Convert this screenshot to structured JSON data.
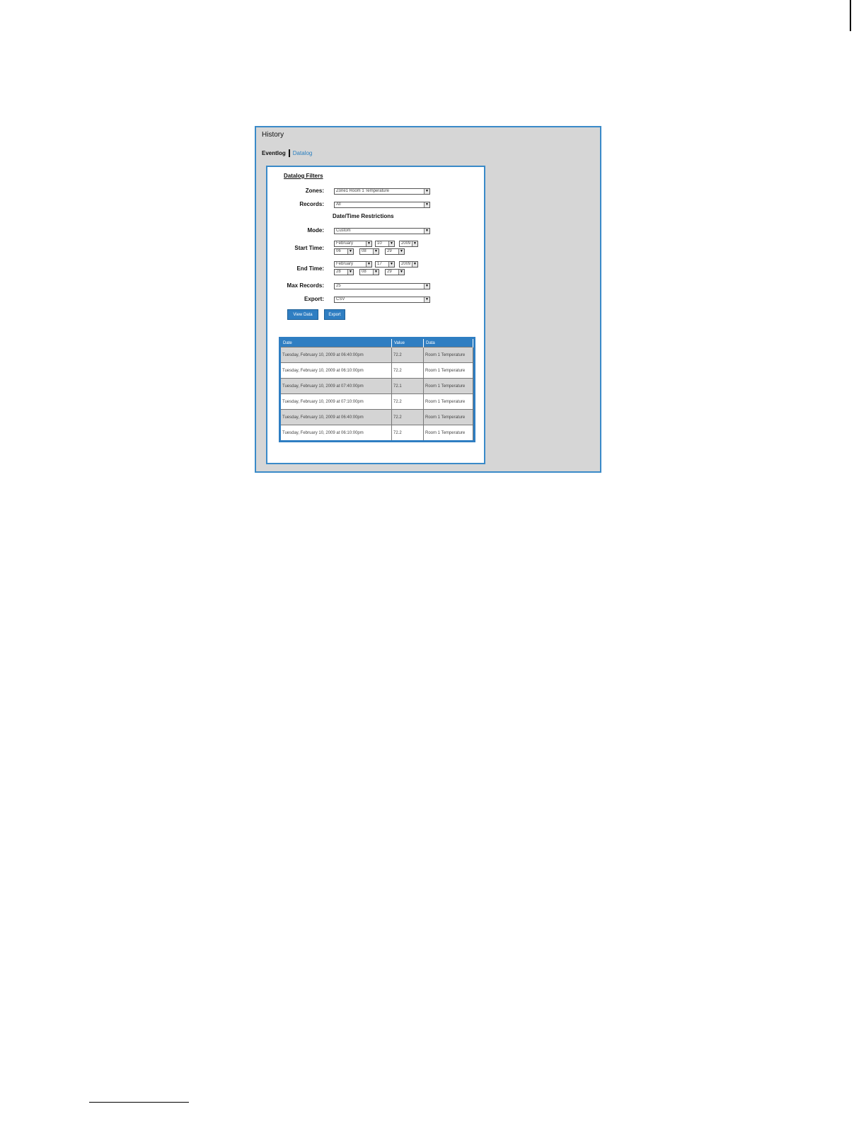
{
  "window": {
    "title": "History",
    "tabs": [
      "Eventlog",
      "Datalog"
    ]
  },
  "filters": {
    "title": "Datalog Filters",
    "zones_label": "Zones:",
    "zones_value": "Zone1 Room 1 Temperature",
    "records_label": "Records:",
    "records_value": "All",
    "section_title": "Date/Time Restrictions",
    "mode_label": "Mode:",
    "mode_value": "Custom",
    "start_label": "Start Time:",
    "start_month": "February",
    "start_day": "10",
    "start_year": "2009",
    "start_hour": "06",
    "start_minute": "08",
    "start_second": "29",
    "end_label": "End Time:",
    "end_month": "February",
    "end_day": "17",
    "end_year": "2009",
    "end_hour": "28",
    "end_minute": "08",
    "end_second": "29",
    "max_label": "Max Records:",
    "max_value": "25",
    "export_label": "Export:",
    "export_value": "CSV",
    "view_button": "View Data",
    "export_button": "Export"
  },
  "table": {
    "headers": [
      "Date",
      "Value",
      "Data"
    ],
    "rows": [
      {
        "date": "Tuesday, February 10, 2009 at 06:40:00pm",
        "value": "72.2",
        "data": "Room 1 Temperature"
      },
      {
        "date": "Tuesday, February 10, 2009 at 06:10:00pm",
        "value": "72.2",
        "data": "Room 1 Temperature"
      },
      {
        "date": "Tuesday, February 10, 2009 at 07:40:00pm",
        "value": "72.1",
        "data": "Room 1 Temperature"
      },
      {
        "date": "Tuesday, February 10, 2009 at 07:10:00pm",
        "value": "72.2",
        "data": "Room 1 Temperature"
      },
      {
        "date": "Tuesday, February 10, 2009 at 06:40:00pm",
        "value": "72.2",
        "data": "Room 1 Temperature"
      },
      {
        "date": "Tuesday, February 10, 2009 at 06:10:00pm",
        "value": "72.2",
        "data": "Room 1 Temperature"
      }
    ]
  },
  "colors": {
    "accent": "#2f7ec2",
    "window_bg": "#d6d6d6",
    "row_shade": "#d4d4d4"
  }
}
